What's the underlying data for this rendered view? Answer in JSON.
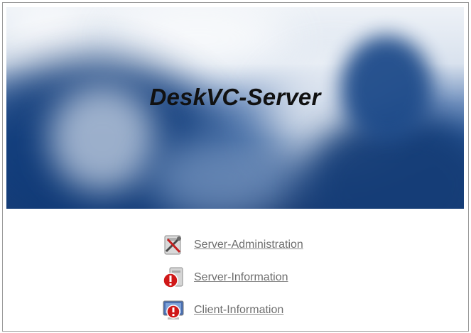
{
  "banner": {
    "title": "DeskVC-Server"
  },
  "links": [
    {
      "label": "Server-Administration",
      "icon": "server-admin-icon"
    },
    {
      "label": "Server-Information",
      "icon": "server-info-icon"
    },
    {
      "label": "Client-Information",
      "icon": "client-info-icon"
    }
  ],
  "colors": {
    "link": "#6e6e6e",
    "banner_blue": "#1d3f75",
    "alert_red": "#d01818"
  }
}
